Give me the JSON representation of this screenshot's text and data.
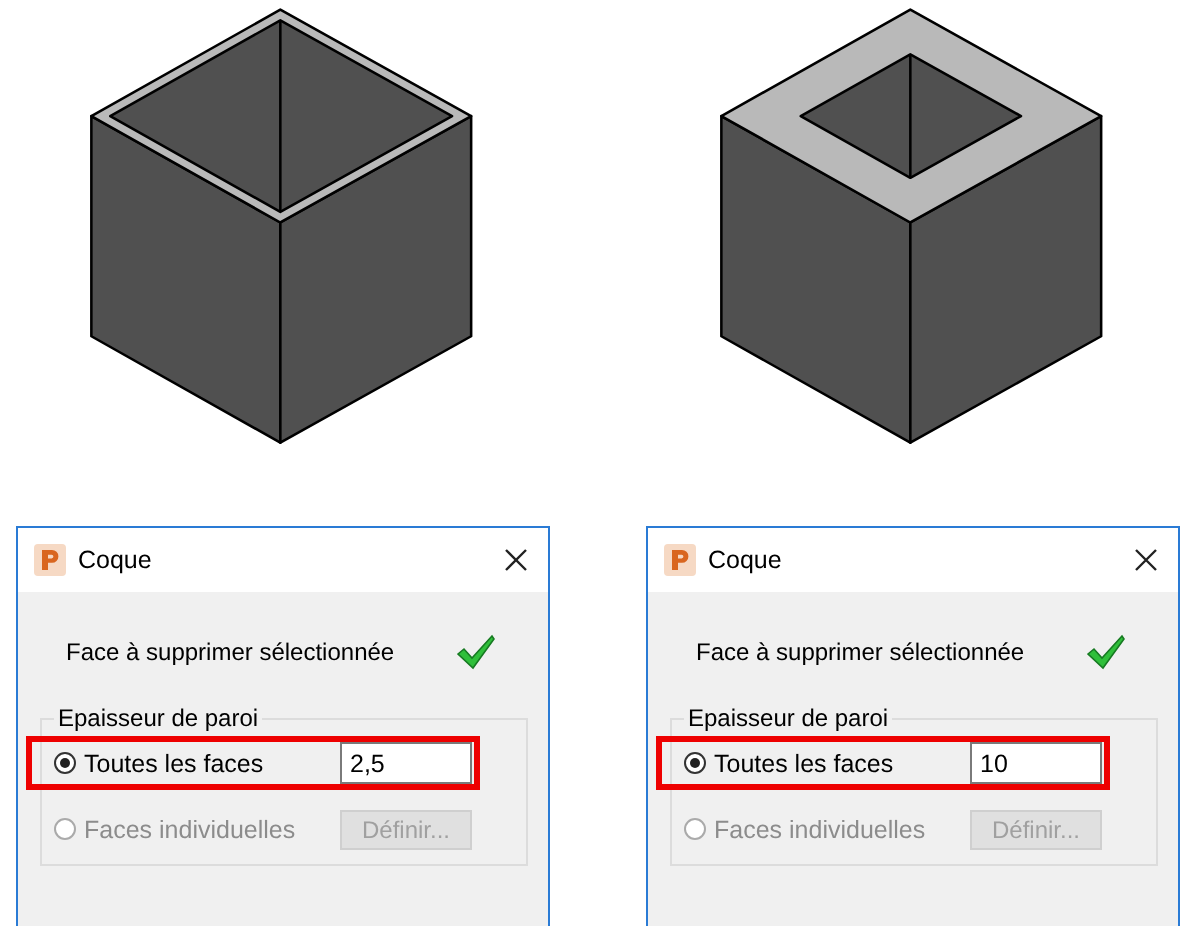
{
  "panels": [
    {
      "model": {
        "kind": "thin-wall"
      },
      "dialog": {
        "title": "Coque",
        "status": {
          "label": "Face à supprimer sélectionnée",
          "done": true
        },
        "group": {
          "legend": "Epaisseur de paroi",
          "options": [
            {
              "kind": "field",
              "label": "Toutes les faces",
              "selected": true,
              "disabled": false,
              "highlighted": true,
              "value": "2,5"
            },
            {
              "kind": "button",
              "label": "Faces individuelles",
              "selected": false,
              "disabled": true,
              "highlighted": false,
              "button": "Définir..."
            }
          ]
        }
      }
    },
    {
      "model": {
        "kind": "thick-wall"
      },
      "dialog": {
        "title": "Coque",
        "status": {
          "label": "Face à supprimer sélectionnée",
          "done": true
        },
        "group": {
          "legend": "Epaisseur de paroi",
          "options": [
            {
              "kind": "field",
              "label": "Toutes les faces",
              "selected": true,
              "disabled": false,
              "highlighted": true,
              "value": "10"
            },
            {
              "kind": "button",
              "label": "Faces individuelles",
              "selected": false,
              "disabled": true,
              "highlighted": false,
              "button": "Définir..."
            }
          ]
        }
      }
    }
  ]
}
